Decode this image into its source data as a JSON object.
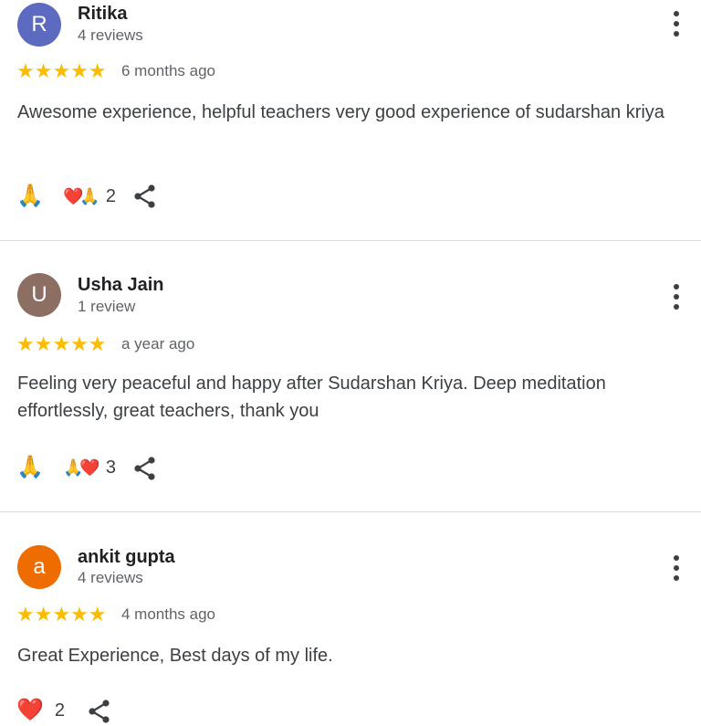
{
  "colors": {
    "star": "#fbbc04",
    "avatar_r": "#5c6bc0",
    "avatar_u": "#8d6e63",
    "avatar_a": "#ef6c00",
    "heart": "#e53935"
  },
  "reviews": [
    {
      "initial": "R",
      "name": "Ritika",
      "review_count": "4 reviews",
      "stars": "★★★★★",
      "date": "6 months ago",
      "text": "Awesome experience, helpful teachers very good experience of sudarshan kriya",
      "react_main": "🙏",
      "react_combo": "❤️🙏",
      "react_count": "2",
      "more_icon": "more-vert-icon",
      "share_icon": "share-icon"
    },
    {
      "initial": "U",
      "name": "Usha Jain",
      "review_count": "1 review",
      "stars": "★★★★★",
      "date": "a year ago",
      "text": "Feeling very peaceful and happy after Sudarshan Kriya. Deep meditation effortlessly, great teachers, thank you",
      "react_main": "🙏",
      "react_combo": "🙏❤️",
      "react_count": "3",
      "more_icon": "more-vert-icon",
      "share_icon": "share-icon"
    },
    {
      "initial": "a",
      "name": "ankit gupta",
      "review_count": "4 reviews",
      "stars": "★★★★★",
      "date": "4 months ago",
      "text": "Great Experience, Best days of my life.",
      "react_main": "❤️",
      "react_count": "2",
      "more_icon": "more-vert-icon",
      "share_icon": "share-icon"
    }
  ]
}
